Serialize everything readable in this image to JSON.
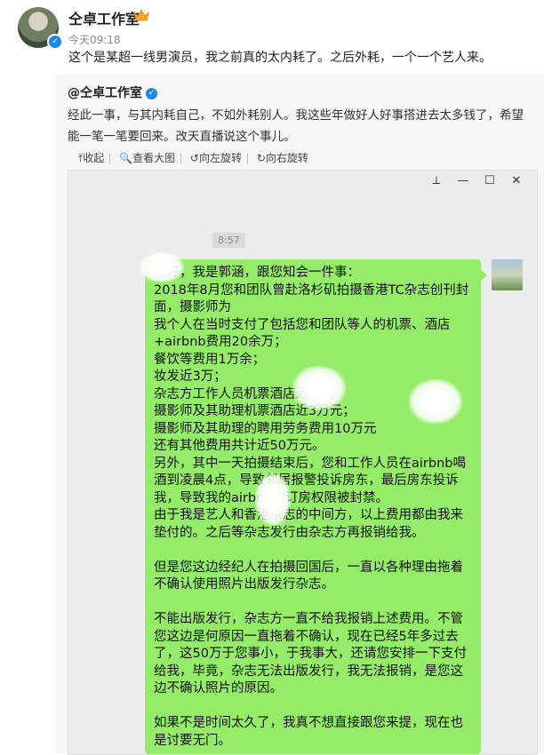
{
  "post": {
    "author": "仝卓工作室",
    "time": "今天09:18",
    "text": "这个是某超一线男演员，我之前真的太内耗了。之后外耗，一个一个艺人来。"
  },
  "quote": {
    "author": "@仝卓工作室",
    "text": "经此一事，与其内耗自己，不如外耗别人。我这些年做好人好事搭进去太多钱了，希望能一笔一笔要回来。改天直播说这个事儿。"
  },
  "toolbar": {
    "collapse": "⤒收起",
    "view_large": "🔍查看大图",
    "rotate_left": "↺向左旋转",
    "rotate_right": "↻向右旋转"
  },
  "chat": {
    "window_controls": [
      "⟂",
      "—",
      "☐",
      "✕"
    ],
    "timestamp": "8:57",
    "message_lines": [
      "您好，我是郭涵，跟您知会一件事：",
      "2018年8月您和团队曾赴洛杉矶拍摄香港TC杂志创刊封面，摄影师为",
      "我个人在当时支付了包括您和团队等人的机票、酒店+airbnb费用20余万；",
      "餐饮等费用1万余；",
      "妆发近3万；",
      "杂志方工作人员机票酒店近2万；",
      "摄影师及其助理机票酒店近3万元；",
      "摄影师及其助理的聘用劳务费用10万元",
      "还有其他费用共计近50万元。",
      "另外，其中一天拍摄结束后，您和工作人员在airbnb喝酒到凌晨4点，导致邻居报警投诉房东，最后房东投诉我，导致我的airbnb的订房权限被封禁。",
      "由于我是艺人和香港杂志的中间方，以上费用都由我来垫付的。之后等杂志发行由杂志方再报销给我。",
      "",
      "但是您这边经纪人在拍摄回国后，一直以各种理由拖着不确认使用照片出版发行杂志。",
      "",
      "不能出版发行，杂志方一直不给我报销上述费用。不管您这边是何原因一直拖着不确认，现在已经5年多过去了，这50万于您事小，于我事大，还请您安排一下支付给我，毕竟，杂志无法出版发行，我无法报销，是您这边不确认照片的原因。",
      "",
      "如果不是时间太久了，我真不想直接跟您来提，现在也是讨要无门。"
    ]
  },
  "colors": {
    "bubble_green": "#95ec69",
    "verified_blue": "#1e88e5"
  }
}
